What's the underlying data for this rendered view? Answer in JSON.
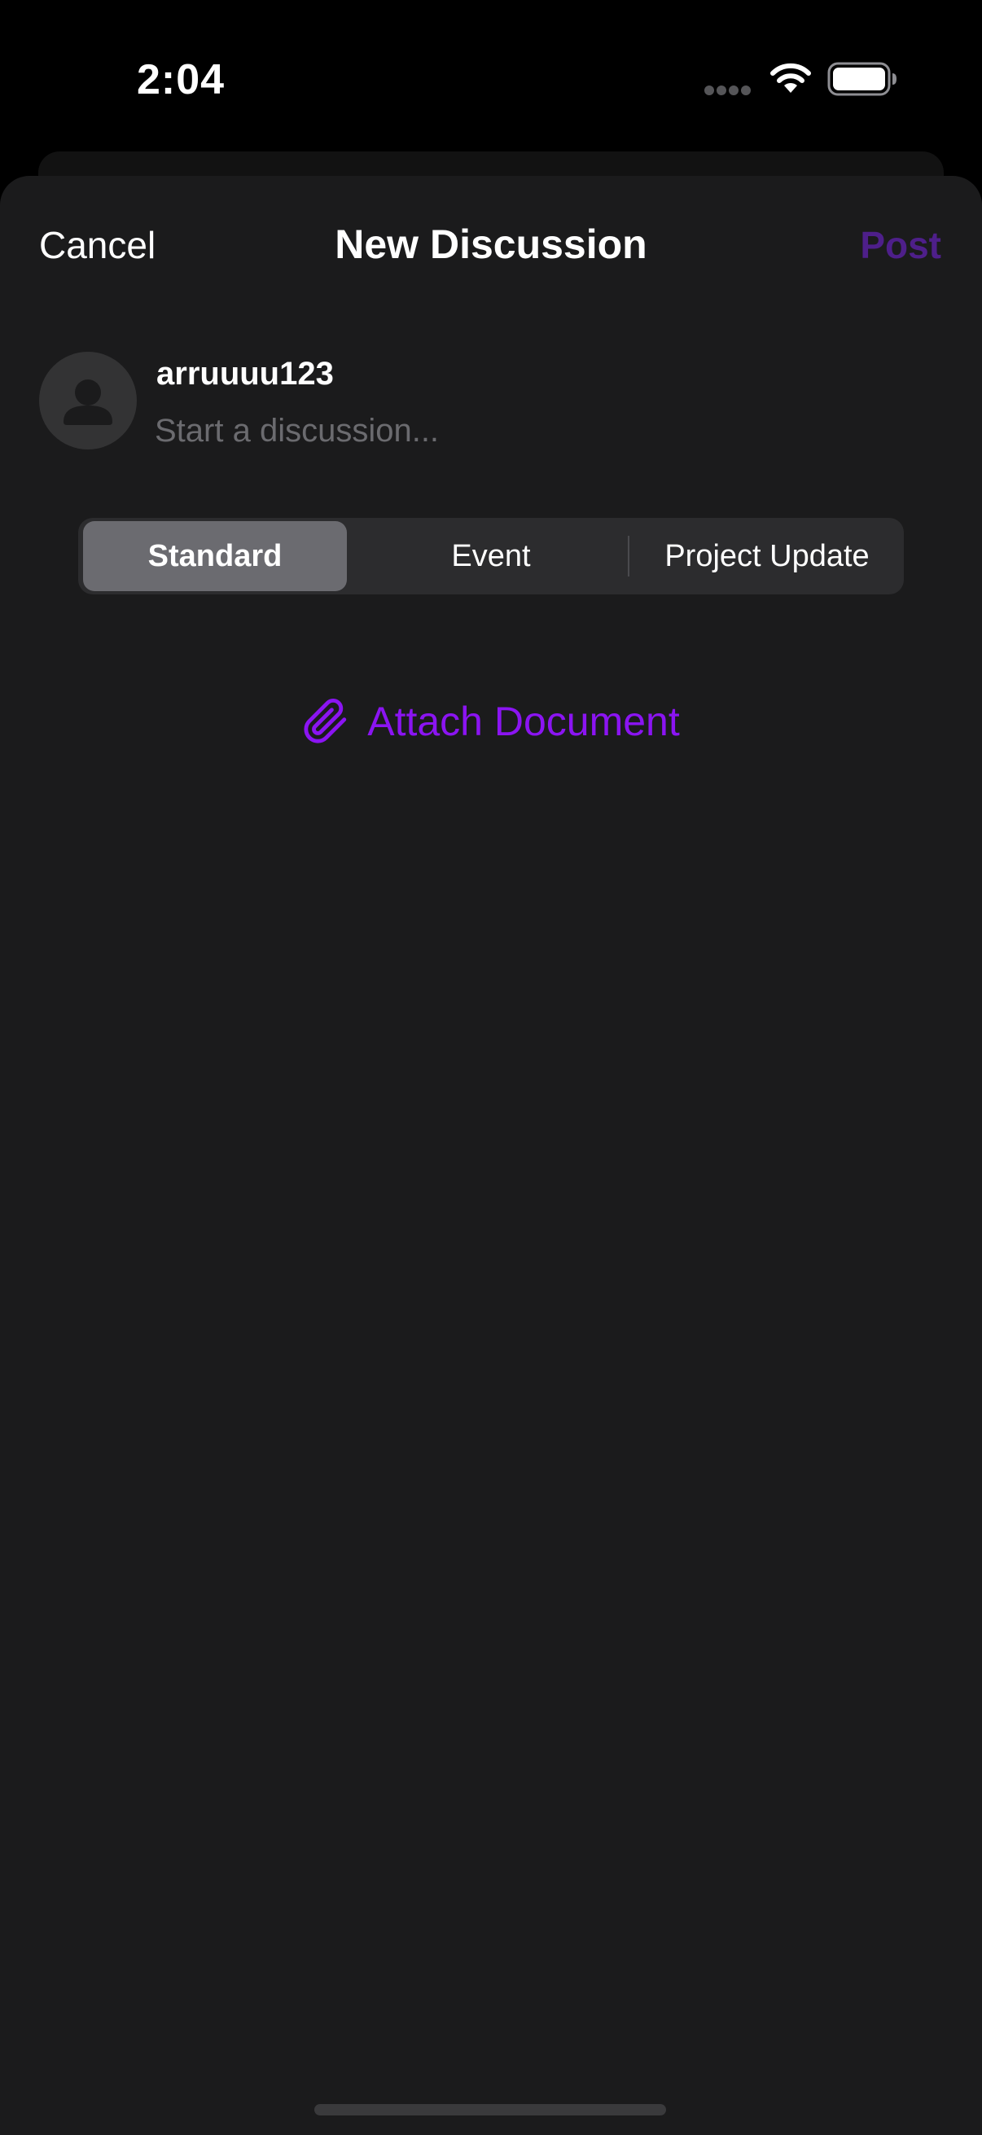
{
  "status_bar": {
    "time": "2:04",
    "icons": [
      "signal-dots-icon",
      "wifi-icon",
      "battery-icon"
    ]
  },
  "nav": {
    "cancel_label": "Cancel",
    "title": "New Discussion",
    "post_label": "Post"
  },
  "composer": {
    "username": "arruuuu123",
    "placeholder": "Start a discussion...",
    "avatar_icon": "person-icon"
  },
  "segments": {
    "items": [
      {
        "label": "Standard",
        "selected": true
      },
      {
        "label": "Event",
        "selected": false
      },
      {
        "label": "Project Update",
        "selected": false
      }
    ]
  },
  "attach": {
    "label": "Attach Document",
    "icon": "paperclip-icon"
  },
  "colors": {
    "background": "#1b1b1c",
    "accent": "#8b14f2",
    "post_disabled": "#4e1f8a",
    "segment_selected": "#6b6b70",
    "segment_track": "#2c2c2e"
  }
}
